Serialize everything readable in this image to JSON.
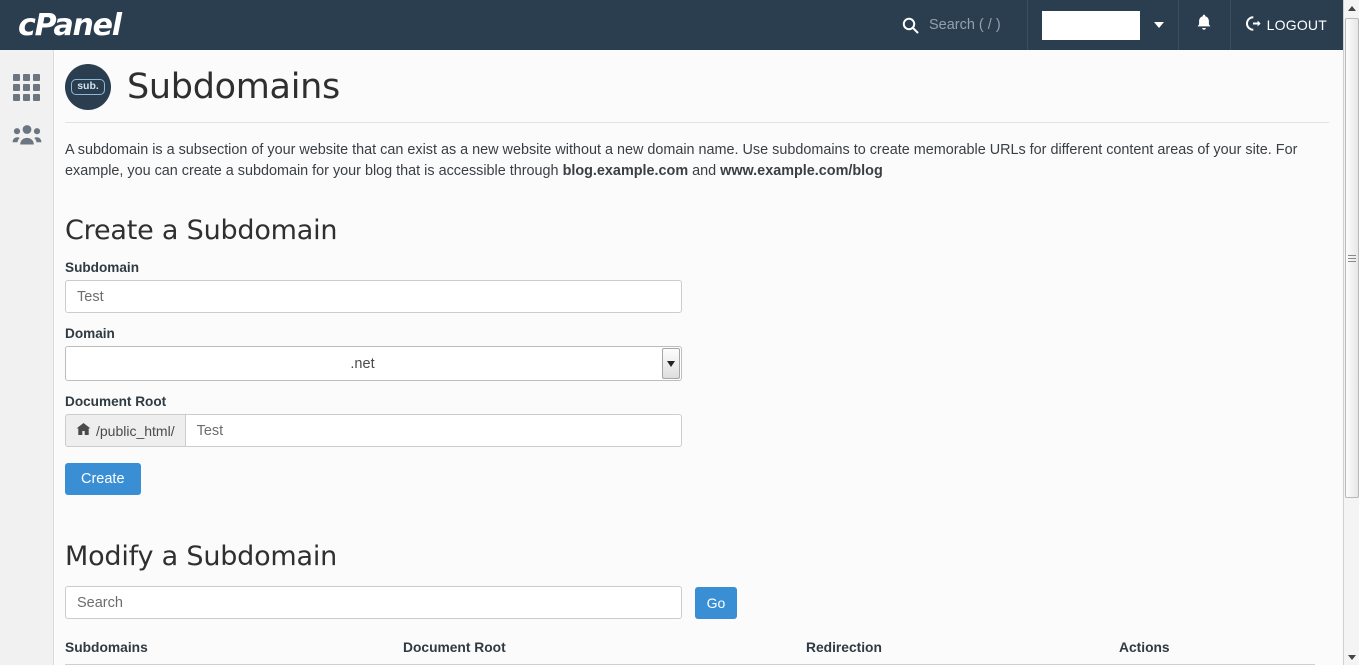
{
  "topbar": {
    "brand": "cPanel",
    "search_placeholder": "Search ( / )",
    "search_icon": "search-icon",
    "user_caret_icon": "chevron-down-icon",
    "bell_icon": "bell-icon",
    "logout_icon": "sign-out-icon",
    "logout_label": "LOGOUT"
  },
  "sidebar": {
    "items": [
      {
        "icon": "grid-apps-icon",
        "name": "apps"
      },
      {
        "icon": "users-group-icon",
        "name": "user-manager"
      }
    ]
  },
  "page": {
    "icon_badge": "sub.",
    "title": "Subdomains",
    "intro_part1": "A subdomain is a subsection of your website that can exist as a new website without a new domain name. Use subdomains to create memorable URLs for different content areas of your site. For example, you can create a subdomain for your blog that is accessible through ",
    "intro_bold1": "blog.example.com",
    "intro_part2": " and ",
    "intro_bold2": "www.example.com/blog"
  },
  "create_section": {
    "heading": "Create a Subdomain",
    "subdomain_label": "Subdomain",
    "subdomain_value": "Test",
    "domain_label": "Domain",
    "domain_selected": ".net",
    "docroot_label": "Document Root",
    "docroot_addon_icon": "home-icon",
    "docroot_addon": "/public_html/",
    "docroot_value": "Test",
    "create_button": "Create"
  },
  "modify_section": {
    "heading": "Modify a Subdomain",
    "search_placeholder": "Search",
    "go_button": "Go",
    "columns": [
      "Subdomains",
      "Document Root",
      "Redirection",
      "Actions"
    ]
  },
  "colors": {
    "header_bg": "#2b3e50",
    "accent_blue": "#3a8fd4",
    "content_bg": "#fbfbfb",
    "sidebar_bg": "#f1f1f1"
  },
  "scrollbar": {
    "up_icon": "scroll-up-arrow-icon",
    "down_icon": "scroll-down-arrow-icon"
  }
}
